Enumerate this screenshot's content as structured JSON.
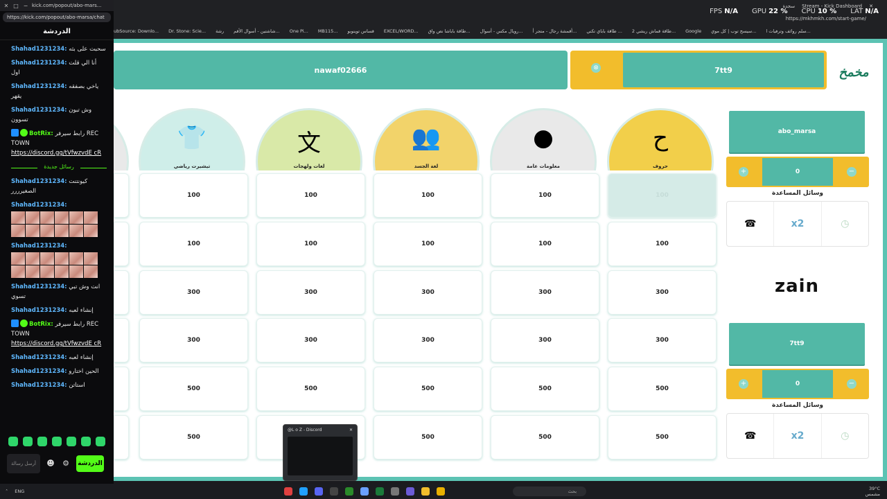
{
  "chat_window": {
    "title_url": "kick.com/popout/abo-mars...",
    "address": "https://kick.com/popout/abo-marsa/chat",
    "header": "الدردشة",
    "messages": [
      {
        "user": "Shahad1231234:",
        "text": "سحبت على بثه"
      },
      {
        "user": "Shahad1231234:",
        "text": "أنا الي قلت اول"
      },
      {
        "user": "Shahad1231234:",
        "text": "ياخي بصفقه يقهر"
      },
      {
        "user": "Shahad1231234:",
        "text": "وش تبون تسوون"
      }
    ],
    "bot_message_1": {
      "user": "BotRix:",
      "text": "رابط سيرفر REC TOWN",
      "link": "https://discord.gg/tVfwzvdE cR"
    },
    "new_messages_divider": "رسائل جديدة",
    "messages_after": [
      {
        "user": "Shahad1231234:",
        "text": "كيونتنت الصغيرررر"
      }
    ],
    "emote_message_1_user": "Shahad1231234:",
    "emote_message_2_user": "Shahad1231234:",
    "messages_after_2": [
      {
        "user": "Shahad1231234:",
        "text": "انت وش تبي تسوي"
      },
      {
        "user": "Shahad1231234:",
        "text": "إنشاء لعبه"
      }
    ],
    "bot_message_2": {
      "user": "BotRix:",
      "text": "رابط سيرفر REC TOWN",
      "link": "https://discord.gg/tVfwzvdE cR"
    },
    "messages_after_3": [
      {
        "user": "Shahad1231234:",
        "text": "إنشاء لعبه"
      },
      {
        "user": "Shahad1231234:",
        "text": "الحين اختارو"
      },
      {
        "user": "Shahad1231234:",
        "text": "استاتن"
      }
    ],
    "input_placeholder": "أرسل رسالة",
    "send_label": "الدردشة"
  },
  "browser": {
    "tab_1": "سجدة",
    "tab_2": "Stream - Kick Dashboard",
    "address": "https://mkhmkh.com/start-game/",
    "bookmarks": [
      "ubSource: Downlo...",
      "Dr. Stone: Scie...",
      "رشة",
      "شاشتين - أسوال الأقم...",
      "One Pi...",
      "MB115...",
      "قساس توينوبو",
      "EXCEL/WORD...",
      "طاقة باباشا نص واق...",
      "رويال مكس - أسوال...",
      "أقمشة رجال - متجر أ...",
      "طاقة باباي تكني ...",
      "طاقة قماش ريشي 2...",
      "Google",
      "سيسج توب | كل موي...",
      "سلم روائف وترفيات ا..."
    ]
  },
  "overlay": {
    "fps_label": "FPS",
    "fps_value": "N/A",
    "gpu_label": "GPU",
    "gpu_value": "22 %",
    "cpu_label": "CPU",
    "cpu_value": "10 %",
    "lat_label": "LAT",
    "lat_value": "N/A"
  },
  "game": {
    "team_left": "nawaf02666",
    "team_right": "7tt9",
    "logo_text": "مخمخ",
    "categories": [
      {
        "label": ""
      },
      {
        "label": "تيشيرت رياضي"
      },
      {
        "label": "لغات ولهجات"
      },
      {
        "label": "لغة الجسد"
      },
      {
        "label": "معلومات عامة"
      },
      {
        "label": "حروف"
      }
    ],
    "rows": [
      [
        "100",
        "100",
        "100",
        "100",
        "100"
      ],
      [
        "100",
        "100",
        "100",
        "100",
        "100"
      ],
      [
        "300",
        "300",
        "300",
        "300",
        "300"
      ],
      [
        "300",
        "300",
        "300",
        "300",
        "300"
      ],
      [
        "500",
        "500",
        "500",
        "500",
        "500"
      ],
      [
        "500",
        "500",
        "500",
        "500",
        "500"
      ]
    ],
    "used_cell_value": "100",
    "player_1": {
      "name": "abo_marsa",
      "score": "0",
      "helpers_title": "وسائل المساعدة",
      "helper_x2": "x2"
    },
    "player_2": {
      "name": "7tt9",
      "score": "0",
      "helpers_title": "وسائل المساعدة",
      "helper_x2": "x2"
    },
    "sponsor": "zain"
  },
  "discord_preview": {
    "title": "@L o Z - Discord"
  },
  "taskbar": {
    "lang": "ENG",
    "search": "بحث",
    "weather": "39°C",
    "weather_sub": "مشمس"
  },
  "colors": {
    "teal": "#52b8a6",
    "gold": "#f2bd2c",
    "kick_green": "#53fc18"
  }
}
